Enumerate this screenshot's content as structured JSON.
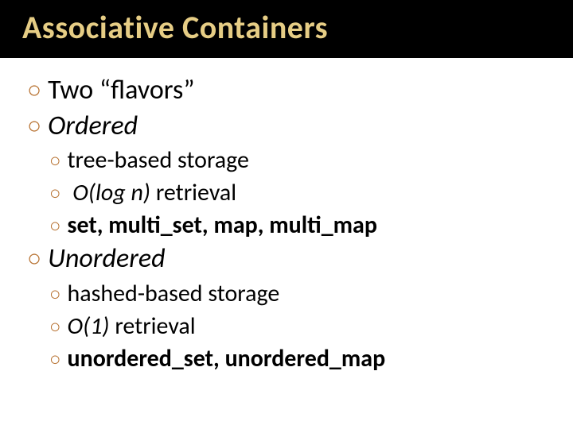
{
  "title": "Associative Containers",
  "items": [
    {
      "level": 1,
      "bold": false,
      "parts": [
        {
          "t": "Two “flavors”",
          "i": false
        }
      ]
    },
    {
      "level": 1,
      "bold": false,
      "parts": [
        {
          "t": "Ordered",
          "i": true
        }
      ]
    },
    {
      "level": 2,
      "bold": false,
      "parts": [
        {
          "t": "tree-based storage",
          "i": false
        }
      ]
    },
    {
      "level": 2,
      "bold": false,
      "parts": [
        {
          "t": " ",
          "i": false
        },
        {
          "t": "O(log n)",
          "i": true
        },
        {
          "t": " retrieval",
          "i": false
        }
      ]
    },
    {
      "level": 2,
      "bold": true,
      "parts": [
        {
          "t": "set, multi_set, map, multi_map",
          "i": false
        }
      ]
    },
    {
      "level": 1,
      "bold": false,
      "parts": [
        {
          "t": "Unordered",
          "i": true
        }
      ]
    },
    {
      "level": 2,
      "bold": false,
      "parts": [
        {
          "t": "hashed-based storage",
          "i": false
        }
      ]
    },
    {
      "level": 2,
      "bold": false,
      "parts": [
        {
          "t": "O(1)",
          "i": true
        },
        {
          "t": " retrieval",
          "i": false
        }
      ]
    },
    {
      "level": 2,
      "bold": true,
      "parts": [
        {
          "t": "unordered_set, unordered_map",
          "i": false
        }
      ]
    }
  ],
  "bullets": {
    "l1": "○",
    "l2": "○"
  }
}
